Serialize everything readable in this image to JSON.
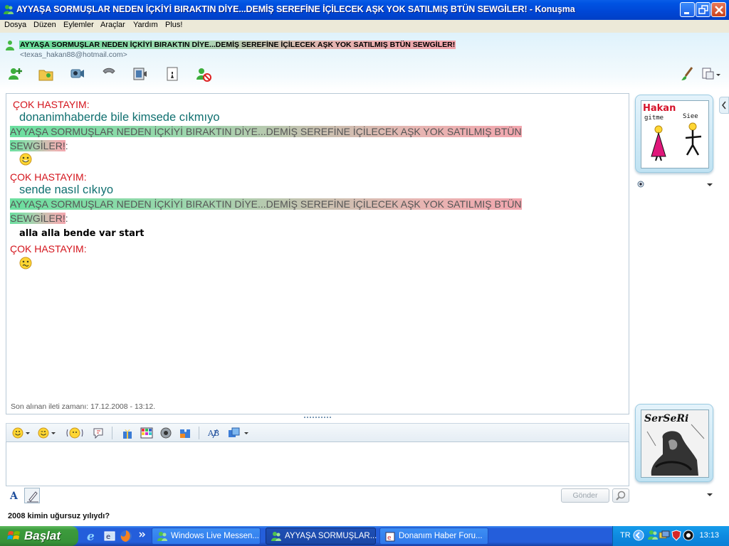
{
  "window": {
    "title": "AYYAŞA SORMUŞLAR NEDEN İÇKİYİ BIRAKTIN DİYE...DEMİŞ SEREFİNE İÇİLECEK AŞK YOK SATILMIŞ BTÜN SEWGİLER! - Konuşma"
  },
  "menu": [
    "Dosya",
    "Düzen",
    "Eylemler",
    "Araçlar",
    "Yardım",
    "Plus!"
  ],
  "contact": {
    "display_name": "AYYAŞA SORMUŞLAR NEDEN İÇKİYİ BIRAKTIN DİYE...DEMİŞ SEREFİNE İÇİLECEK AŞK YOK SATILMIŞ BTÜN SEWGİLER!",
    "email": "<texas_hakan88@hotmail.com>"
  },
  "toolbar_icons": [
    "invite-contact-icon",
    "send-files-icon",
    "webcam-icon",
    "call-icon",
    "video-icon",
    "games-icon",
    "block-icon"
  ],
  "conversation": {
    "self_name": "ÇOK HASTAYIM:",
    "self_name_first": " ÇOK HASTAYIM:",
    "other_name": "AYYAŞA SORMUŞLAR NEDEN İÇKİYİ BIRAKTIN DİYE...DEMİŞ SEREFİNE İÇİLECEK AŞK YOK SATILMIŞ BTÜN",
    "other_name_cont": "SEWGİLER!",
    "colon": ":",
    "messages": {
      "m1": "donanimhaberde bile kimsede cıkmıyo",
      "m2": "sende nasıl cıkıyo",
      "m3": "alla alla bende var start"
    },
    "last_message_time": "Son alınan ileti zamanı: 17.12.2008 - 13:12."
  },
  "avatars": {
    "contact_avatar_text": {
      "brand": "Hakan",
      "left": "gitme",
      "right": "Siee"
    },
    "self_avatar_text": "SerSeRi"
  },
  "input": {
    "send_label": "Gönder",
    "value": ""
  },
  "status_text": "2008 kimin uğursuz yılıydı?",
  "taskbar": {
    "start_label": "Başlat",
    "tasks": [
      {
        "label": "Windows Live Messen..."
      },
      {
        "label": "AYYAŞA SORMUŞLAR..."
      },
      {
        "label": "Donanım Haber Foru..."
      }
    ],
    "language": "TR",
    "clock": "13:13"
  },
  "colors": {
    "sender_red": "#d4141c",
    "message_teal": "#107070",
    "xp_blue": "#0054e3"
  }
}
